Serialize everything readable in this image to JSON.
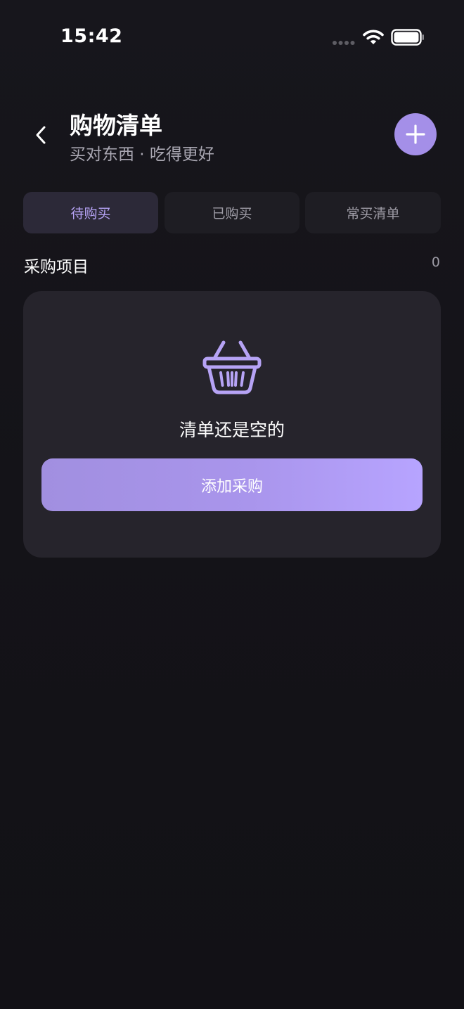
{
  "status_bar": {
    "time": "15:42"
  },
  "header": {
    "title": "购物清单",
    "subtitle": "买对东西 · 吃得更好"
  },
  "tabs": [
    {
      "label": "待购买",
      "active": true
    },
    {
      "label": "已购买",
      "active": false
    },
    {
      "label": "常买清单",
      "active": false
    }
  ],
  "section": {
    "title": "采购项目",
    "count": "0"
  },
  "empty_state": {
    "message": "清单还是空的",
    "button_label": "添加采购"
  },
  "colors": {
    "accent": "#a48fe8",
    "background": "#141318",
    "card": "#26242c"
  },
  "icons": [
    "back-icon",
    "plus-icon",
    "basket-icon",
    "signal-icon",
    "wifi-icon",
    "battery-icon"
  ]
}
